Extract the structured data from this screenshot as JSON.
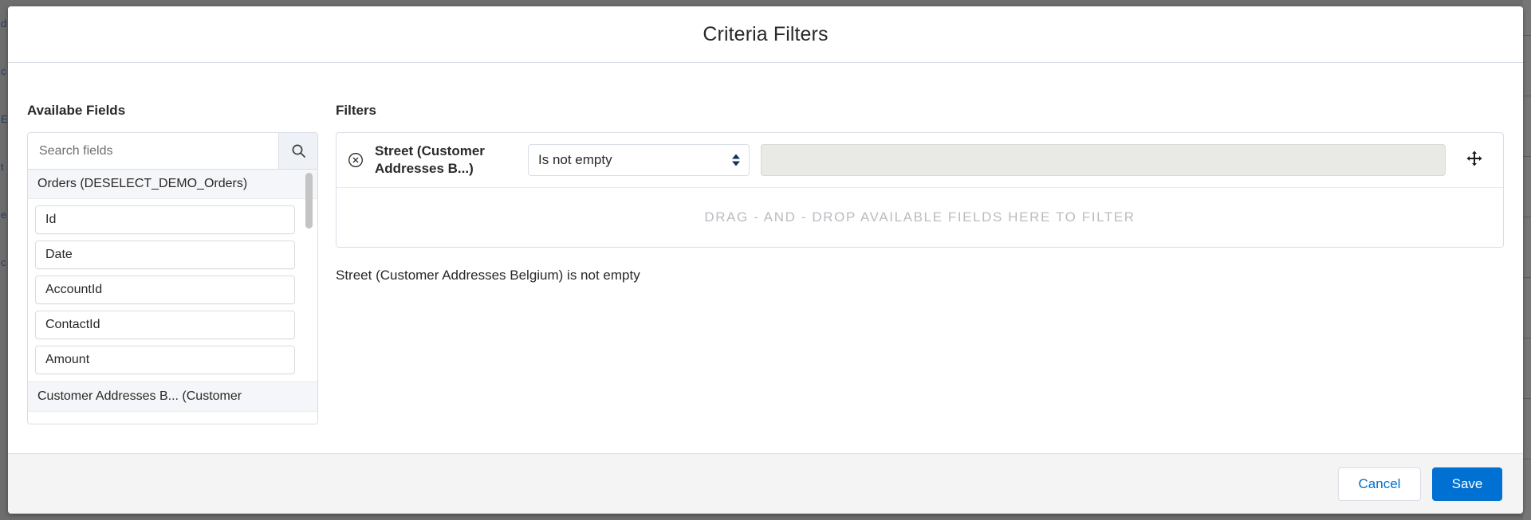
{
  "modal": {
    "title": "Criteria Filters"
  },
  "available_fields": {
    "heading": "Availabe Fields",
    "search": {
      "placeholder": "Search fields",
      "value": "",
      "icon": "search-icon"
    },
    "groups": [
      {
        "label": "Orders (DESELECT_DEMO_Orders)",
        "fields": [
          "Id",
          "Date",
          "AccountId",
          "ContactId",
          "Amount"
        ]
      },
      {
        "label": "Customer Addresses B... (Customer",
        "fields": []
      }
    ]
  },
  "filters": {
    "heading": "Filters",
    "rows": [
      {
        "remove_icon": "remove-circle-icon",
        "field_label": "Street (Customer Addresses B...)",
        "operator": "Is not empty",
        "value": "",
        "drag_icon": "move-handle-icon"
      }
    ],
    "dropzone_text": "DRAG - AND - DROP AVAILABLE FIELDS HERE TO FILTER",
    "summary": "Street (Customer Addresses Belgium) is not empty"
  },
  "footer": {
    "cancel_label": "Cancel",
    "save_label": "Save"
  },
  "colors": {
    "accent": "#0070d2",
    "backdrop": "#6d6d6d",
    "footer_bg": "#f4f4f4",
    "disabled_input": "#e9e9e6"
  },
  "backdrop": {
    "left_glyphs": [
      "d",
      "c",
      "E",
      "t",
      "e",
      "c"
    ]
  }
}
